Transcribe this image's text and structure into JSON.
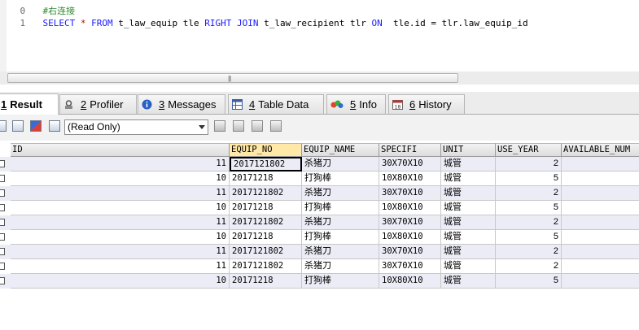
{
  "editor": {
    "line0_num": "0",
    "line0_comment": "#右连接",
    "line1_num": "1",
    "tokens": {
      "select": "SELECT",
      "star": "*",
      "from": "FROM",
      "t1": "t_law_equip tle",
      "right_join": "RIGHT JOIN",
      "t2": "t_law_recipient tlr",
      "on": "ON",
      "cond_left": "tle.id",
      "eq": "=",
      "cond_right": "tlr.law_equip_id"
    }
  },
  "tabs": [
    {
      "num": "1",
      "label": "Result",
      "icon": "result-icon",
      "active": true
    },
    {
      "num": "2",
      "label": "Profiler",
      "icon": "profiler-icon"
    },
    {
      "num": "3",
      "label": "Messages",
      "icon": "info-icon"
    },
    {
      "num": "4",
      "label": "Table Data",
      "icon": "table-icon"
    },
    {
      "num": "5",
      "label": "Info",
      "icon": "pie-chart-icon"
    },
    {
      "num": "6",
      "label": "History",
      "icon": "calendar-icon"
    }
  ],
  "toolbar": {
    "mode_value": "(Read Only)"
  },
  "grid": {
    "columns": [
      "ID",
      "EQUIP_NO",
      "EQUIP_NAME",
      "SPECIFI",
      "UNIT",
      "USE_YEAR",
      "AVAILABLE_NUM"
    ],
    "rows": [
      [
        "11",
        "2017121802",
        "杀猪刀",
        "30X70X10",
        "城管",
        "2",
        ""
      ],
      [
        "10",
        "20171218",
        "打狗棒",
        "10X80X10",
        "城管",
        "5",
        ""
      ],
      [
        "11",
        "2017121802",
        "杀猪刀",
        "30X70X10",
        "城管",
        "2",
        ""
      ],
      [
        "10",
        "20171218",
        "打狗棒",
        "10X80X10",
        "城管",
        "5",
        ""
      ],
      [
        "11",
        "2017121802",
        "杀猪刀",
        "30X70X10",
        "城管",
        "2",
        ""
      ],
      [
        "10",
        "20171218",
        "打狗棒",
        "10X80X10",
        "城管",
        "5",
        ""
      ],
      [
        "11",
        "2017121802",
        "杀猪刀",
        "30X70X10",
        "城管",
        "2",
        ""
      ],
      [
        "11",
        "2017121802",
        "杀猪刀",
        "30X70X10",
        "城管",
        "2",
        ""
      ],
      [
        "10",
        "20171218",
        "打狗棒",
        "10X80X10",
        "城管",
        "5",
        ""
      ]
    ]
  },
  "colors": {
    "keyword": "#1a1aff",
    "comment": "#2f8a2f",
    "operator": "#c00000",
    "row_alt": "#ececf6",
    "selected_header": "#ffe8a8"
  }
}
